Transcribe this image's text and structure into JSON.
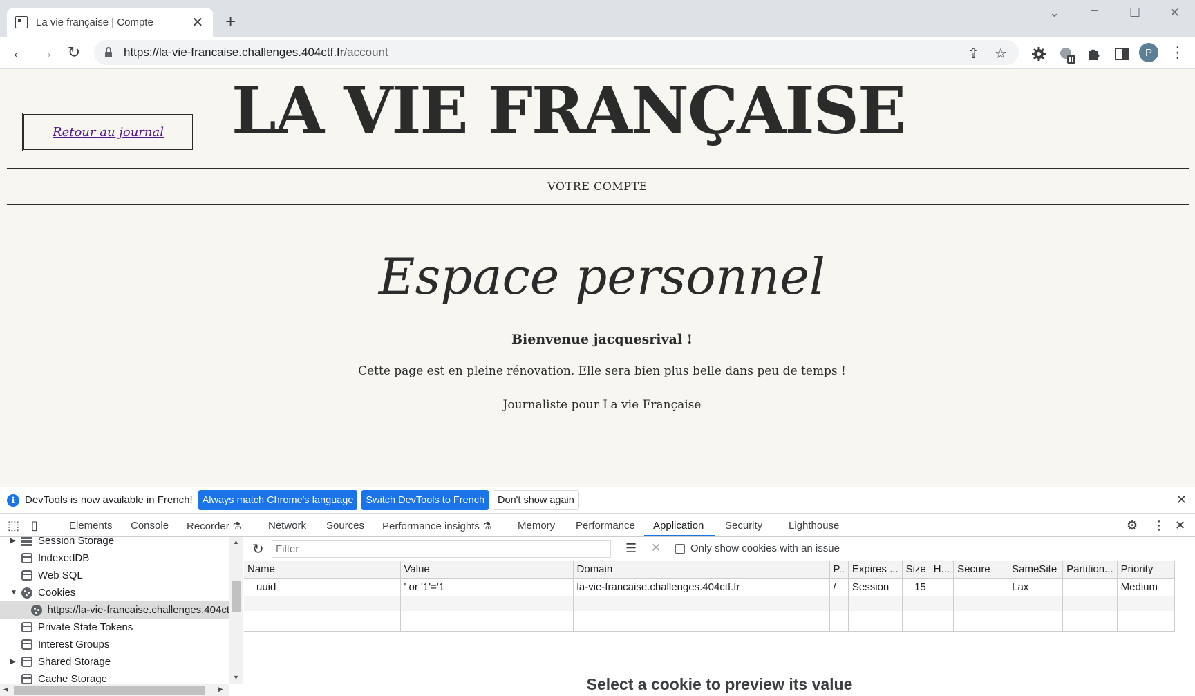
{
  "browser": {
    "tab_title": "La vie française | Compte",
    "tab_close": "✕",
    "new_tab": "+",
    "url_host": "https://la-vie-francaise.challenges.404ctf.fr",
    "url_path": "/account",
    "profile_initial": "P"
  },
  "page": {
    "back_link": "Retour au journal",
    "masthead": "LA VIE FRANÇAISE",
    "section": "VOTRE COMPTE",
    "heading": "Espace personnel",
    "welcome": "Bienvenue jacquesrival !",
    "renovation": "Cette page est en pleine rénovation. Elle sera bien plus belle dans peu de temps !",
    "role": "Journaliste pour La vie Française"
  },
  "devtools": {
    "infobar": {
      "message": "DevTools is now available in French!",
      "btn_match": "Always match Chrome's language",
      "btn_switch": "Switch DevTools to French",
      "btn_dismiss": "Don't show again"
    },
    "tabs": [
      "Elements",
      "Console",
      "Recorder",
      "Network",
      "Sources",
      "Performance insights",
      "Memory",
      "Performance",
      "Application",
      "Security",
      "Lighthouse"
    ],
    "active_tab": "Application",
    "sidebar": [
      "Session Storage",
      "IndexedDB",
      "Web SQL",
      "Cookies",
      "https://la-vie-francaise.challenges.404ct",
      "Private State Tokens",
      "Interest Groups",
      "Shared Storage",
      "Cache Storage"
    ],
    "filter_placeholder": "Filter",
    "only_issue_label": "Only show cookies with an issue",
    "columns": [
      "Name",
      "Value",
      "Domain",
      "P..",
      "Expires ...",
      "Size",
      "H...",
      "Secure",
      "SameSite",
      "Partition...",
      "Priority"
    ],
    "rows": [
      [
        "uuid",
        "' or '1'='1",
        "la-vie-francaise.challenges.404ctf.fr",
        "/",
        "Session",
        "15",
        "",
        "",
        "Lax",
        "",
        "Medium"
      ]
    ],
    "preview_text": "Select a cookie to preview its value"
  }
}
